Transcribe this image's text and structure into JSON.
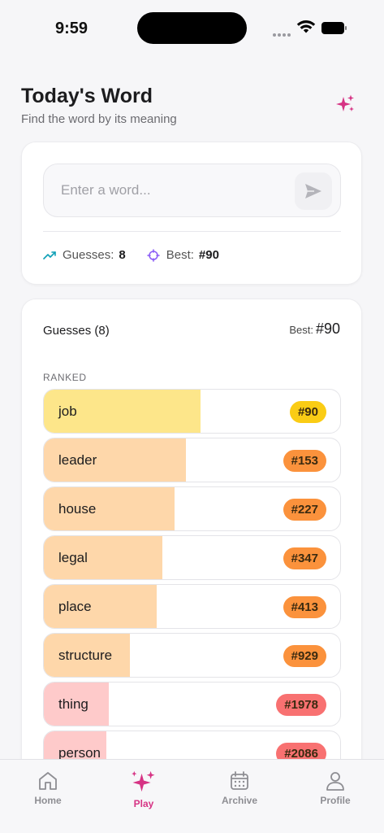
{
  "status": {
    "time": "9:59"
  },
  "header": {
    "title": "Today's Word",
    "subtitle": "Find the word by its meaning",
    "sparkle_icon": "sparkles-icon"
  },
  "input": {
    "placeholder": "Enter a word...",
    "value": "",
    "send_icon": "send-icon"
  },
  "stats": {
    "guesses_label": "Guesses:",
    "guesses_value": "8",
    "best_label": "Best:",
    "best_value": "#90"
  },
  "guesses": {
    "title": "Guesses (8)",
    "best_label": "Best:",
    "best_value": "#90",
    "ranked_label": "RANKED",
    "rows": [
      {
        "word": "job",
        "rank": "#90",
        "level": 0.53,
        "fill": "#fde68a",
        "badge": "#facc15"
      },
      {
        "word": "leader",
        "rank": "#153",
        "level": 0.48,
        "fill": "#fed7aa",
        "badge": "#fb923c"
      },
      {
        "word": "house",
        "rank": "#227",
        "level": 0.44,
        "fill": "#fed7aa",
        "badge": "#fb923c"
      },
      {
        "word": "legal",
        "rank": "#347",
        "level": 0.4,
        "fill": "#fed7aa",
        "badge": "#fb923c"
      },
      {
        "word": "place",
        "rank": "#413",
        "level": 0.38,
        "fill": "#fed7aa",
        "badge": "#fb923c"
      },
      {
        "word": "structure",
        "rank": "#929",
        "level": 0.29,
        "fill": "#fed7aa",
        "badge": "#fb923c"
      },
      {
        "word": "thing",
        "rank": "#1978",
        "level": 0.22,
        "fill": "#fecaca",
        "badge": "#f87171"
      },
      {
        "word": "person",
        "rank": "#2086",
        "level": 0.21,
        "fill": "#fecaca",
        "badge": "#f87171"
      }
    ]
  },
  "tabs": [
    {
      "label": "Home",
      "icon": "home-icon"
    },
    {
      "label": "Play",
      "icon": "sparkles-icon",
      "active": true
    },
    {
      "label": "Archive",
      "icon": "calendar-icon"
    },
    {
      "label": "Profile",
      "icon": "user-icon"
    }
  ],
  "colors": {
    "accent": "#d63384"
  }
}
